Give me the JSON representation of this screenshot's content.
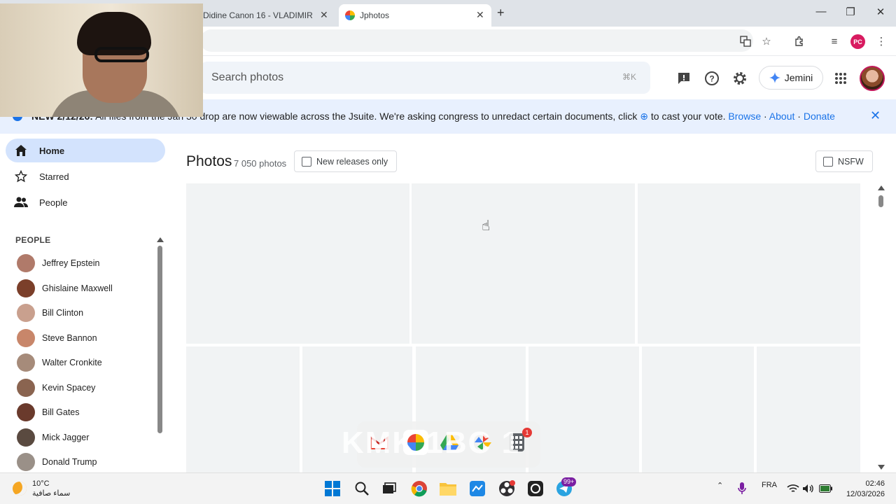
{
  "browser": {
    "tabs": [
      {
        "title": "Didine Canon 16 - VLADIMIR X",
        "active": false
      },
      {
        "title": "Jphotos",
        "active": true
      }
    ],
    "new_tab": "+",
    "window_controls": {
      "minimize": "—",
      "maximize": "❐",
      "close": "✕"
    },
    "profile_badge": "PC"
  },
  "header": {
    "search_placeholder": "Search photos",
    "search_shortcut": "⌘K",
    "jemini_label": "Jemini"
  },
  "banner": {
    "prefix": "NEW 2/12/26:",
    "text_before_link": "All files from the Jan 30 drop are now viewable across the Jsuite. We're asking congress to unredact certain documents, click ",
    "text_after_icon": " to cast your vote. ",
    "links": [
      "Browse",
      "About",
      "Donate"
    ],
    "close": "✕"
  },
  "sidebar": {
    "nav": [
      {
        "label": "Home",
        "icon": "home-icon",
        "active": true
      },
      {
        "label": "Starred",
        "icon": "star-icon",
        "active": false
      },
      {
        "label": "People",
        "icon": "people-icon",
        "active": false
      }
    ],
    "people_heading": "PEOPLE",
    "people": [
      {
        "name": "Jeffrey Epstein",
        "color": "#b07a6a"
      },
      {
        "name": "Ghislaine Maxwell",
        "color": "#7b3f2a"
      },
      {
        "name": "Bill Clinton",
        "color": "#c9a08e"
      },
      {
        "name": "Steve Bannon",
        "color": "#c8866a"
      },
      {
        "name": "Walter Cronkite",
        "color": "#a68b7a"
      },
      {
        "name": "Kevin Spacey",
        "color": "#8a6450"
      },
      {
        "name": "Bill Gates",
        "color": "#6a3a2c"
      },
      {
        "name": "Mick Jagger",
        "color": "#5a4a40"
      },
      {
        "name": "Donald Trump",
        "color": "#9a9088"
      }
    ]
  },
  "main": {
    "title": "Photos",
    "count": "7 050 photos",
    "filters": {
      "new_releases": "New releases only",
      "nsfw": "NSFW"
    }
  },
  "dock": {
    "ghost_text": "KMK 1BC 1",
    "badge": "1"
  },
  "taskbar": {
    "weather_temp": "10°C",
    "weather_desc": "سماء صافية",
    "language": "FRA",
    "time": "02:46",
    "date": "12/03/2026",
    "messenger_badge": "99+"
  },
  "colors": {
    "accent": "#1a73e8",
    "active_nav": "#d3e3fd",
    "banner_bg": "#e8f0fe",
    "tile": "#f1f3f4"
  }
}
